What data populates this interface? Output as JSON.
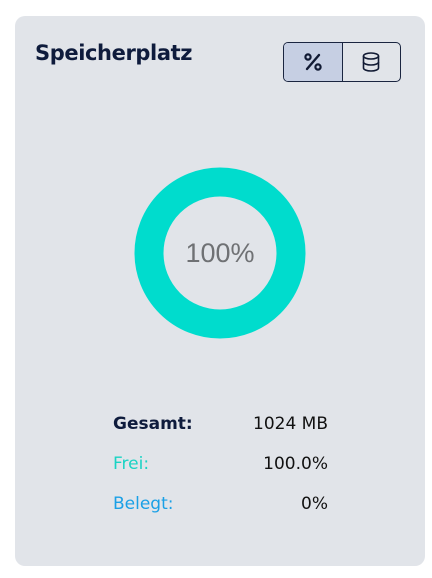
{
  "card": {
    "title": "Speicherplatz"
  },
  "toggle": {
    "options": [
      {
        "icon": "percent-icon",
        "glyph": "%",
        "active": true
      },
      {
        "icon": "database-icon",
        "active": false
      }
    ]
  },
  "donut": {
    "label": "100%",
    "free_fraction": 1.0,
    "free_color": "#00dccd",
    "used_color": "#1aa0e6"
  },
  "stats": {
    "total_label": "Gesamt:",
    "total_value": "1024 MB",
    "free_label": "Frei:",
    "free_value": "100.0%",
    "used_label": "Belegt:",
    "used_value": "0%"
  },
  "colors": {
    "card_bg": "#e1e4e9",
    "title": "#0e1b3c",
    "free": "#19d3c4",
    "used": "#1aa0e6",
    "toggle_active": "#c6cfe3"
  }
}
